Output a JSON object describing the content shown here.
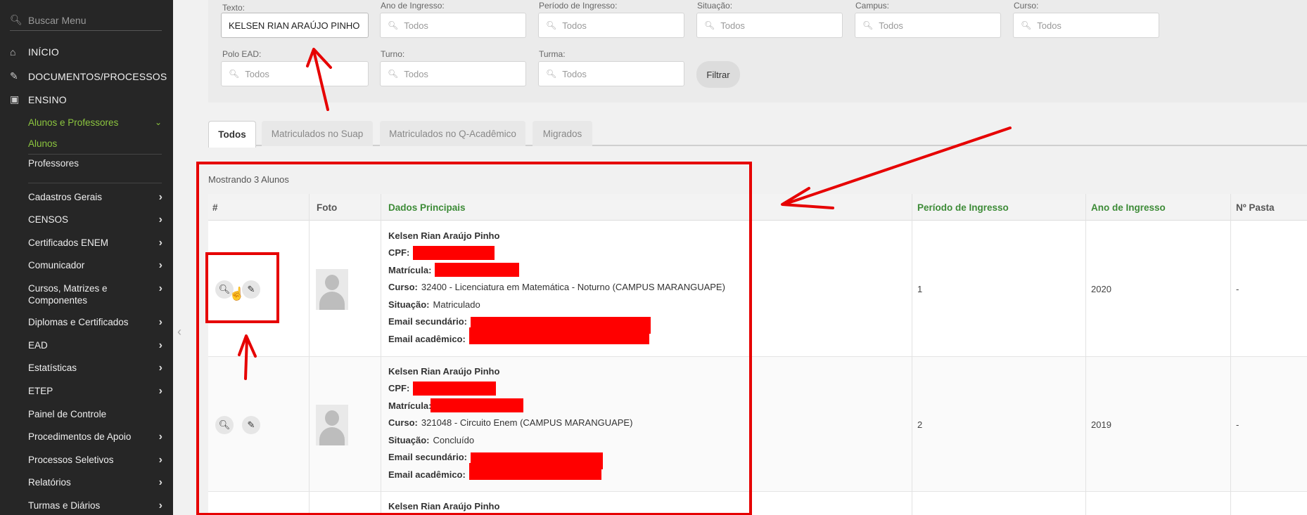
{
  "sidebar": {
    "search_placeholder": "Buscar Menu",
    "main": [
      {
        "label": "INÍCIO",
        "icon": "home-icon"
      },
      {
        "label": "DOCUMENTOS/PROCESSOS",
        "icon": "document-icon"
      },
      {
        "label": "ENSINO",
        "icon": "teaching-icon"
      }
    ],
    "ensino_sub": {
      "group": "Alunos e Professores",
      "active": "Alunos",
      "other": "Professores"
    },
    "items": [
      {
        "label": "Cadastros Gerais",
        "arrow": true
      },
      {
        "label": "CENSOS",
        "arrow": true
      },
      {
        "label": "Certificados ENEM",
        "arrow": true
      },
      {
        "label": "Comunicador",
        "arrow": true
      },
      {
        "label": "Cursos, Matrizes e Componentes",
        "arrow": true
      },
      {
        "label": "Diplomas e Certificados",
        "arrow": true
      },
      {
        "label": "EAD",
        "arrow": true
      },
      {
        "label": "Estatísticas",
        "arrow": true
      },
      {
        "label": "ETEP",
        "arrow": true
      },
      {
        "label": "Painel de Controle",
        "arrow": false
      },
      {
        "label": "Procedimentos de Apoio",
        "arrow": true
      },
      {
        "label": "Processos Seletivos",
        "arrow": true
      },
      {
        "label": "Relatórios",
        "arrow": true
      },
      {
        "label": "Turmas e Diários",
        "arrow": true
      }
    ]
  },
  "filters": {
    "texto_label": "Texto:",
    "texto_value": "KELSEN RIAN ARAÚJO PINHO",
    "fields": [
      {
        "label": "Ano de Ingresso:",
        "value": "Todos"
      },
      {
        "label": "Período de Ingresso:",
        "value": "Todos"
      },
      {
        "label": "Situação:",
        "value": "Todos"
      },
      {
        "label": "Campus:",
        "value": "Todos"
      },
      {
        "label": "Curso:",
        "value": "Todos"
      },
      {
        "label": "Polo EAD:",
        "value": "Todos"
      },
      {
        "label": "Turno:",
        "value": "Todos"
      },
      {
        "label": "Turma:",
        "value": "Todos"
      }
    ],
    "button": "Filtrar"
  },
  "tabs": [
    "Todos",
    "Matriculados no Suap",
    "Matriculados no Q-Acadêmico",
    "Migrados"
  ],
  "showing": "Mostrando 3 Alunos",
  "table": {
    "headers": [
      "#",
      "Foto",
      "Dados Principais",
      "Período de Ingresso",
      "Ano de Ingresso",
      "Nº Pasta"
    ],
    "labels": {
      "cpf": "CPF:",
      "matricula": "Matrícula:",
      "curso": "Curso:",
      "situacao": "Situação:",
      "email_sec": "Email secundário:",
      "email_acad": "Email acadêmico:"
    },
    "rows": [
      {
        "name": "Kelsen Rian Araújo Pinho",
        "curso": "32400 - Licenciatura em Matemática - Noturno (CAMPUS MARANGUAPE)",
        "situacao": "Matriculado",
        "periodo": "1",
        "ano": "2020",
        "pasta": "-"
      },
      {
        "name": "Kelsen Rian Araújo Pinho",
        "curso": "321048 - Circuito Enem (CAMPUS MARANGUAPE)",
        "situacao": "Concluído",
        "periodo": "2",
        "ano": "2019",
        "pasta": "-"
      },
      {
        "name": "Kelsen Rian Araújo Pinho"
      }
    ]
  },
  "colors": {
    "annotation": "#e60000",
    "accent_green": "#8cc63f",
    "header_green": "#3d8b37"
  }
}
